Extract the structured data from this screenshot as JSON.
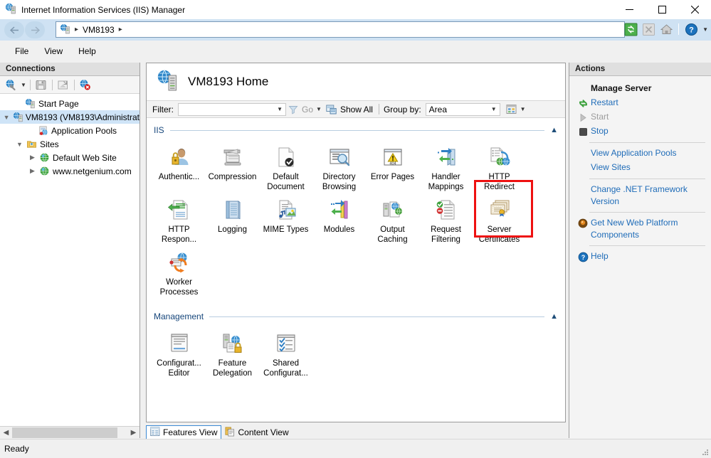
{
  "window": {
    "title": "Internet Information Services (IIS) Manager",
    "icon": "iis-manager-icon",
    "minimize_label": "—",
    "maximize_label": "☐",
    "close_label": "✕"
  },
  "address_bar": {
    "back_label": "←",
    "forward_label": "→",
    "breadcrumb_icon": "server-icon",
    "separator": "▸",
    "crumb": "VM8193",
    "tools": [
      {
        "name": "refresh-button",
        "icon": "refresh-icon",
        "enabled": true
      },
      {
        "name": "stop-button",
        "icon": "stop-x-icon",
        "enabled": false
      },
      {
        "name": "home-button",
        "icon": "home-icon",
        "enabled": true
      },
      {
        "name": "help-button",
        "icon": "help-icon",
        "enabled": true
      }
    ]
  },
  "menu": {
    "items": [
      "File",
      "View",
      "Help"
    ]
  },
  "connections": {
    "header": "Connections",
    "toolbar": [
      {
        "name": "connect-button",
        "icon": "connect-globe-icon",
        "has_caret": true
      },
      {
        "name": "save-connections-button",
        "icon": "save-disk-icon",
        "has_caret": false
      },
      {
        "name": "export-connections-button",
        "icon": "export-icon",
        "has_caret": false
      },
      {
        "name": "disconnect-button",
        "icon": "disconnect-globe-icon",
        "has_caret": false
      }
    ],
    "tree": [
      {
        "label": "Start Page",
        "icon": "start-page-icon",
        "indent": 1,
        "twist": "",
        "selected": false
      },
      {
        "label": "VM8193 (VM8193\\Administrat",
        "icon": "server-icon",
        "indent": 1,
        "twist": "expanded",
        "selected": true
      },
      {
        "label": "Application Pools",
        "icon": "app-pools-icon",
        "indent": 2,
        "twist": "",
        "selected": false
      },
      {
        "label": "Sites",
        "icon": "sites-folder-icon",
        "indent": 2,
        "twist": "expanded",
        "selected": false
      },
      {
        "label": "Default Web Site",
        "icon": "website-globe-icon",
        "indent": 3,
        "twist": "collapsed",
        "selected": false
      },
      {
        "label": "www.netgenium.com",
        "icon": "website-globe-icon",
        "indent": 3,
        "twist": "collapsed",
        "selected": false
      }
    ]
  },
  "main": {
    "page_title": "VM8193 Home",
    "page_icon": "server-home-icon",
    "filter": {
      "label": "Filter:",
      "value": "",
      "placeholder": "",
      "go_label": "Go",
      "show_all_label": "Show All",
      "group_by_label": "Group by:",
      "group_by_value": "Area"
    },
    "groups": [
      {
        "name": "IIS",
        "collapsed": false,
        "features": [
          {
            "label": "Authentic...",
            "icon": "authentication-icon"
          },
          {
            "label": "Compression",
            "icon": "compression-icon"
          },
          {
            "label": "Default Document",
            "icon": "default-document-icon"
          },
          {
            "label": "Directory Browsing",
            "icon": "directory-browsing-icon"
          },
          {
            "label": "Error Pages",
            "icon": "error-pages-icon"
          },
          {
            "label": "Handler Mappings",
            "icon": "handler-mappings-icon"
          },
          {
            "label": "HTTP Redirect",
            "icon": "http-redirect-icon"
          },
          {
            "label": "HTTP Respon...",
            "icon": "http-response-headers-icon"
          },
          {
            "label": "Logging",
            "icon": "logging-icon"
          },
          {
            "label": "MIME Types",
            "icon": "mime-types-icon"
          },
          {
            "label": "Modules",
            "icon": "modules-icon"
          },
          {
            "label": "Output Caching",
            "icon": "output-caching-icon"
          },
          {
            "label": "Request Filtering",
            "icon": "request-filtering-icon"
          },
          {
            "label": "Server Certificates",
            "icon": "server-certificates-icon",
            "highlighted": true
          },
          {
            "label": "Worker Processes",
            "icon": "worker-processes-icon"
          }
        ]
      },
      {
        "name": "Management",
        "collapsed": false,
        "features": [
          {
            "label": "Configurat... Editor",
            "icon": "configuration-editor-icon"
          },
          {
            "label": "Feature Delegation",
            "icon": "feature-delegation-icon"
          },
          {
            "label": "Shared Configurat...",
            "icon": "shared-configuration-icon"
          }
        ]
      }
    ],
    "view_tabs": [
      {
        "label": "Features View",
        "icon": "features-view-icon",
        "active": true
      },
      {
        "label": "Content View",
        "icon": "content-view-icon",
        "active": false
      }
    ]
  },
  "actions": {
    "header": "Actions",
    "groups": [
      {
        "title": "Manage Server",
        "items": [
          {
            "label": "Restart",
            "icon": "restart-icon",
            "enabled": true
          },
          {
            "label": "Start",
            "icon": "start-play-icon",
            "enabled": false
          },
          {
            "label": "Stop",
            "icon": "stop-square-icon",
            "enabled": true
          }
        ]
      },
      {
        "title": "",
        "items": [
          {
            "label": "View Application Pools",
            "icon": "",
            "enabled": true
          },
          {
            "label": "View Sites",
            "icon": "",
            "enabled": true
          }
        ]
      },
      {
        "title": "",
        "items": [
          {
            "label": "Change .NET Framework Version",
            "icon": "",
            "enabled": true
          }
        ]
      },
      {
        "title": "",
        "items": [
          {
            "label": "Get New Web Platform Components",
            "icon": "web-pi-icon",
            "enabled": true
          }
        ]
      },
      {
        "title": "",
        "items": [
          {
            "label": "Help",
            "icon": "help-blue-icon",
            "enabled": true
          }
        ]
      }
    ]
  },
  "status_bar": {
    "text": "Ready"
  },
  "colors": {
    "accent_blue": "#1f6cb8",
    "group_title": "#16467b",
    "highlight_red": "#ee1111",
    "selection": "#cfe4f7",
    "addressbar": "#cfe2f3"
  }
}
